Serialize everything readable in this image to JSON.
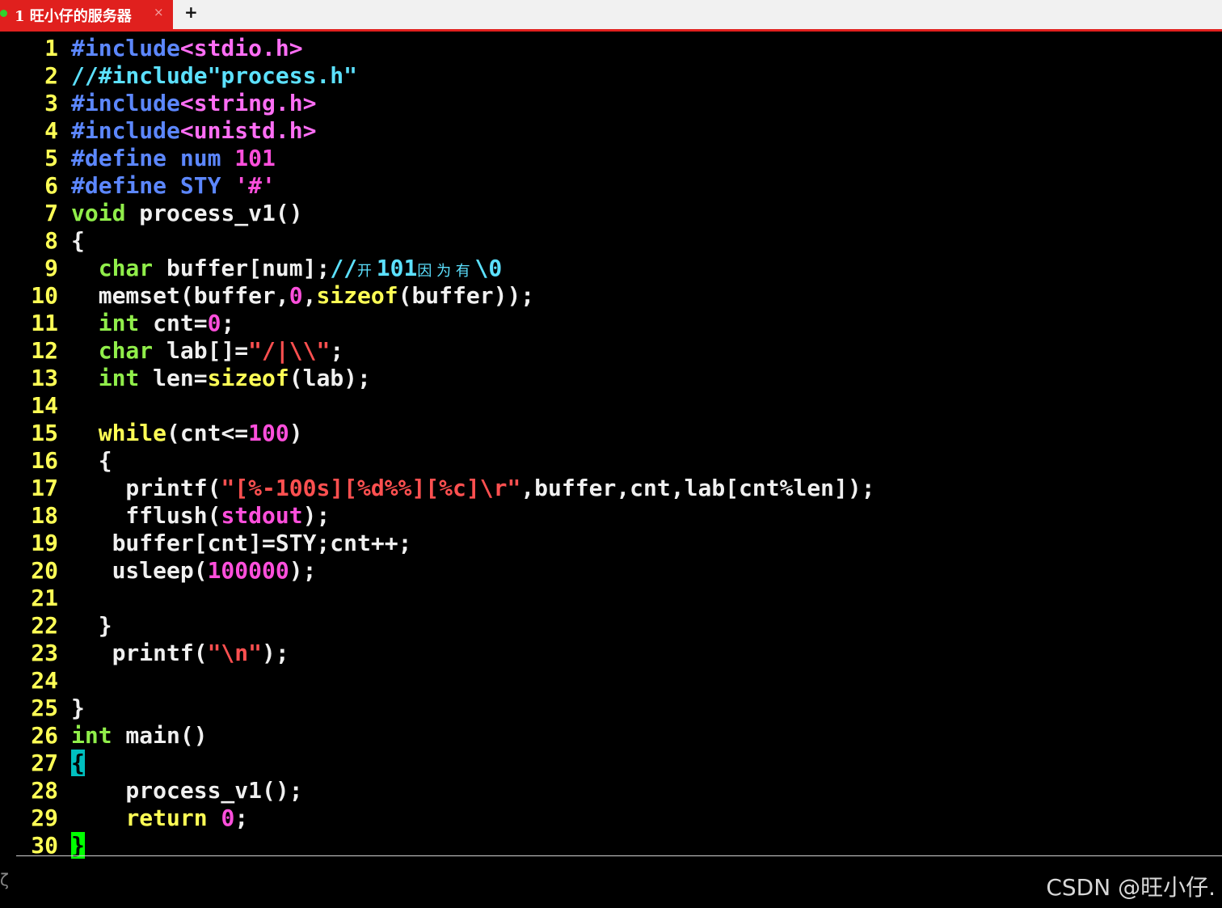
{
  "tab": {
    "title": "1 旺小仔的服务器",
    "close": "×",
    "new": "+"
  },
  "status": {
    "left_glyph": "ζ"
  },
  "watermark": "CSDN @旺小仔.",
  "lines": [
    {
      "n": "1",
      "tokens": [
        {
          "t": "#include",
          "c": "pp"
        },
        {
          "t": "<stdio.h>",
          "c": "inc"
        }
      ]
    },
    {
      "n": "2",
      "tokens": [
        {
          "t": "//#include\"process.h\"",
          "c": "cmt"
        }
      ]
    },
    {
      "n": "3",
      "tokens": [
        {
          "t": "#include",
          "c": "pp"
        },
        {
          "t": "<string.h>",
          "c": "inc"
        }
      ]
    },
    {
      "n": "4",
      "tokens": [
        {
          "t": "#include",
          "c": "pp"
        },
        {
          "t": "<unistd.h>",
          "c": "inc"
        }
      ]
    },
    {
      "n": "5",
      "tokens": [
        {
          "t": "#define num ",
          "c": "pp"
        },
        {
          "t": "101",
          "c": "num"
        }
      ]
    },
    {
      "n": "6",
      "tokens": [
        {
          "t": "#define STY ",
          "c": "pp"
        },
        {
          "t": "'#'",
          "c": "num"
        }
      ]
    },
    {
      "n": "7",
      "tokens": [
        {
          "t": "void",
          "c": "type"
        },
        {
          "t": " process_v1()",
          "c": "plain"
        }
      ]
    },
    {
      "n": "8",
      "tokens": [
        {
          "t": "{",
          "c": "plain"
        }
      ]
    },
    {
      "n": "9",
      "tokens": [
        {
          "t": "  ",
          "c": "plain"
        },
        {
          "t": "char",
          "c": "type"
        },
        {
          "t": " buffer[num];",
          "c": "plain"
        },
        {
          "t": "//",
          "c": "cmt"
        },
        {
          "t": "开 ",
          "c": "cjk"
        },
        {
          "t": "101",
          "c": "cmt"
        },
        {
          "t": "因 为 有 ",
          "c": "cjk"
        },
        {
          "t": "\\0",
          "c": "cmt"
        }
      ]
    },
    {
      "n": "10",
      "tokens": [
        {
          "t": "  memset(buffer,",
          "c": "plain"
        },
        {
          "t": "0",
          "c": "num"
        },
        {
          "t": ",",
          "c": "plain"
        },
        {
          "t": "sizeof",
          "c": "stmt"
        },
        {
          "t": "(buffer));",
          "c": "plain"
        }
      ]
    },
    {
      "n": "11",
      "tokens": [
        {
          "t": "  ",
          "c": "plain"
        },
        {
          "t": "int",
          "c": "type"
        },
        {
          "t": " cnt=",
          "c": "plain"
        },
        {
          "t": "0",
          "c": "num"
        },
        {
          "t": ";",
          "c": "plain"
        }
      ]
    },
    {
      "n": "12",
      "tokens": [
        {
          "t": "  ",
          "c": "plain"
        },
        {
          "t": "char",
          "c": "type"
        },
        {
          "t": " lab[]=",
          "c": "plain"
        },
        {
          "t": "\"/|\\\\\"",
          "c": "str"
        },
        {
          "t": ";",
          "c": "plain"
        }
      ]
    },
    {
      "n": "13",
      "tokens": [
        {
          "t": "  ",
          "c": "plain"
        },
        {
          "t": "int",
          "c": "type"
        },
        {
          "t": " len=",
          "c": "plain"
        },
        {
          "t": "sizeof",
          "c": "stmt"
        },
        {
          "t": "(lab);",
          "c": "plain"
        }
      ]
    },
    {
      "n": "14",
      "tokens": []
    },
    {
      "n": "15",
      "tokens": [
        {
          "t": "  ",
          "c": "plain"
        },
        {
          "t": "while",
          "c": "stmt"
        },
        {
          "t": "(cnt<=",
          "c": "plain"
        },
        {
          "t": "100",
          "c": "num"
        },
        {
          "t": ")",
          "c": "plain"
        }
      ]
    },
    {
      "n": "16",
      "tokens": [
        {
          "t": "  {",
          "c": "plain"
        }
      ]
    },
    {
      "n": "17",
      "tokens": [
        {
          "t": "    printf(",
          "c": "plain"
        },
        {
          "t": "\"[%-100s][%d%%][%c]\\r\"",
          "c": "str"
        },
        {
          "t": ",buffer,cnt,lab[cnt%len]);",
          "c": "plain"
        }
      ]
    },
    {
      "n": "18",
      "tokens": [
        {
          "t": "    fflush(",
          "c": "plain"
        },
        {
          "t": "stdout",
          "c": "num"
        },
        {
          "t": ");",
          "c": "plain"
        }
      ]
    },
    {
      "n": "19",
      "tokens": [
        {
          "t": "   buffer[cnt]=STY;cnt++;",
          "c": "plain"
        }
      ]
    },
    {
      "n": "20",
      "tokens": [
        {
          "t": "   usleep(",
          "c": "plain"
        },
        {
          "t": "100000",
          "c": "num"
        },
        {
          "t": ");",
          "c": "plain"
        }
      ]
    },
    {
      "n": "21",
      "tokens": []
    },
    {
      "n": "22",
      "tokens": [
        {
          "t": "  }",
          "c": "plain"
        }
      ]
    },
    {
      "n": "23",
      "tokens": [
        {
          "t": "   printf(",
          "c": "plain"
        },
        {
          "t": "\"\\n\"",
          "c": "str"
        },
        {
          "t": ");",
          "c": "plain"
        }
      ]
    },
    {
      "n": "24",
      "tokens": []
    },
    {
      "n": "25",
      "tokens": [
        {
          "t": "}",
          "c": "plain"
        }
      ]
    },
    {
      "n": "26",
      "tokens": [
        {
          "t": "int",
          "c": "type"
        },
        {
          "t": " main()",
          "c": "plain"
        }
      ]
    },
    {
      "n": "27",
      "tokens": [
        {
          "t": "{",
          "c": "plain cur-cyan"
        }
      ]
    },
    {
      "n": "28",
      "tokens": [
        {
          "t": "    process_v1();",
          "c": "plain"
        }
      ]
    },
    {
      "n": "29",
      "tokens": [
        {
          "t": "    ",
          "c": "plain"
        },
        {
          "t": "return",
          "c": "stmt"
        },
        {
          "t": " ",
          "c": "plain"
        },
        {
          "t": "0",
          "c": "num"
        },
        {
          "t": ";",
          "c": "plain"
        }
      ]
    },
    {
      "n": "30",
      "tokens": [
        {
          "t": "}",
          "c": "plain cur-green"
        }
      ]
    }
  ]
}
